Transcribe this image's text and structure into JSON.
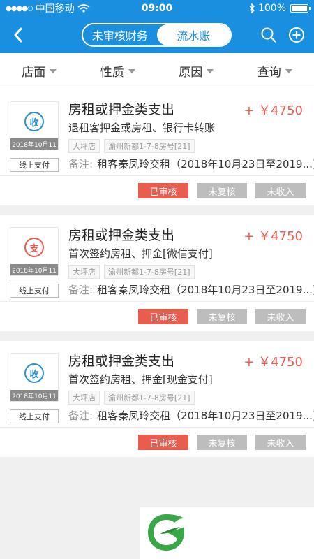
{
  "status": {
    "carrier": "中国移动",
    "time": "09:00",
    "battery": "100%"
  },
  "header": {
    "tabs": [
      {
        "label": "未审核财务",
        "active": true
      },
      {
        "label": "流水账",
        "active": false
      }
    ]
  },
  "filters": [
    {
      "label": "店面"
    },
    {
      "label": "性质"
    },
    {
      "label": "原因"
    },
    {
      "label": "查询"
    }
  ],
  "records": [
    {
      "type_char": "收",
      "type": "in",
      "date": "2018年10月11",
      "payment": "线上支付",
      "title": "房租或押金类支出",
      "amount": "+ ￥4750",
      "desc": "退租客押金或房租、银行卡转账",
      "store": "大坪店",
      "address": "渝州新都1-7-8房号[21]",
      "note_label": "备注:",
      "note": "租客秦凤玲交租（2018年10月23日至2019...)",
      "actions": [
        "已审核",
        "未复核",
        "未收入"
      ]
    },
    {
      "type_char": "支",
      "type": "out",
      "date": "2018年10月11",
      "payment": "线上支付",
      "title": "房租或押金类支出",
      "amount": "+ ￥4750",
      "desc": "首次签约房租、押金[微信支付]",
      "store": "大坪店",
      "address": "渝州新都1-7-8房号[21]",
      "note_label": "备注:",
      "note": "租客秦凤玲交租（2018年10月23日至2019...)",
      "actions": [
        "已审核",
        "未复核",
        "未收入"
      ]
    },
    {
      "type_char": "收",
      "type": "in",
      "date": "2018年10月11",
      "payment": "线上支付",
      "title": "房租或押金类支出",
      "amount": "+ ￥4750",
      "desc": "首次签约房租、押金[现金支付]",
      "store": "大坪店",
      "address": "渝州新都1-7-8房号[21]",
      "note_label": "备注:",
      "note": "租客秦凤玲交租（2018年10月23日至2019...)",
      "actions": [
        "已审核",
        "未复核",
        "未收入"
      ]
    }
  ],
  "colors": {
    "primary": "#1a8fe0",
    "accent": "#e95d4f",
    "muted": "#bdbdbd",
    "logo_green": "#3aa647"
  },
  "icons": {
    "back": "chevron-left-icon",
    "search": "search-icon",
    "add": "plus-circle-icon",
    "wifi": "wifi-icon",
    "bluetooth": "bluetooth-icon",
    "battery": "battery-icon",
    "logo": "leaf-logo-icon"
  }
}
